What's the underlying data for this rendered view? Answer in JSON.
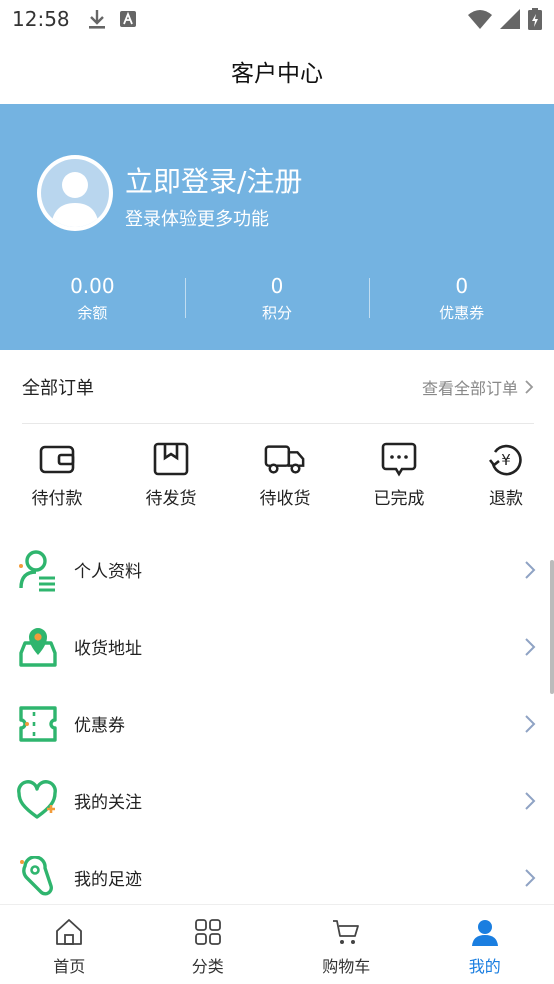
{
  "status": {
    "time": "12:58"
  },
  "header": {
    "title": "客户中心"
  },
  "profile": {
    "login_title": "立即登录/注册",
    "login_sub": "登录体验更多功能"
  },
  "stats": [
    {
      "value": "0.00",
      "label": "余额"
    },
    {
      "value": "0",
      "label": "积分"
    },
    {
      "value": "0",
      "label": "优惠券"
    }
  ],
  "orders": {
    "title": "全部订单",
    "view_all": "查看全部订单",
    "items": [
      {
        "label": "待付款",
        "icon": "wallet-icon"
      },
      {
        "label": "待发货",
        "icon": "package-icon"
      },
      {
        "label": "待收货",
        "icon": "truck-icon"
      },
      {
        "label": "已完成",
        "icon": "chat-check-icon"
      },
      {
        "label": "退款",
        "icon": "refund-icon"
      }
    ]
  },
  "menu": {
    "items": [
      {
        "label": "个人资料",
        "icon": "profile-icon"
      },
      {
        "label": "收货地址",
        "icon": "location-icon"
      },
      {
        "label": "优惠券",
        "icon": "coupon-icon"
      },
      {
        "label": "我的关注",
        "icon": "heart-icon"
      },
      {
        "label": "我的足迹",
        "icon": "footprint-icon"
      }
    ]
  },
  "tabs": [
    {
      "label": "首页",
      "icon": "home-icon"
    },
    {
      "label": "分类",
      "icon": "grid-icon"
    },
    {
      "label": "购物车",
      "icon": "cart-icon"
    },
    {
      "label": "我的",
      "icon": "user-icon"
    }
  ],
  "colors": {
    "hero": "#74b3e1",
    "accent_green": "#2fb56e",
    "tab_active": "#1a7ee0"
  }
}
